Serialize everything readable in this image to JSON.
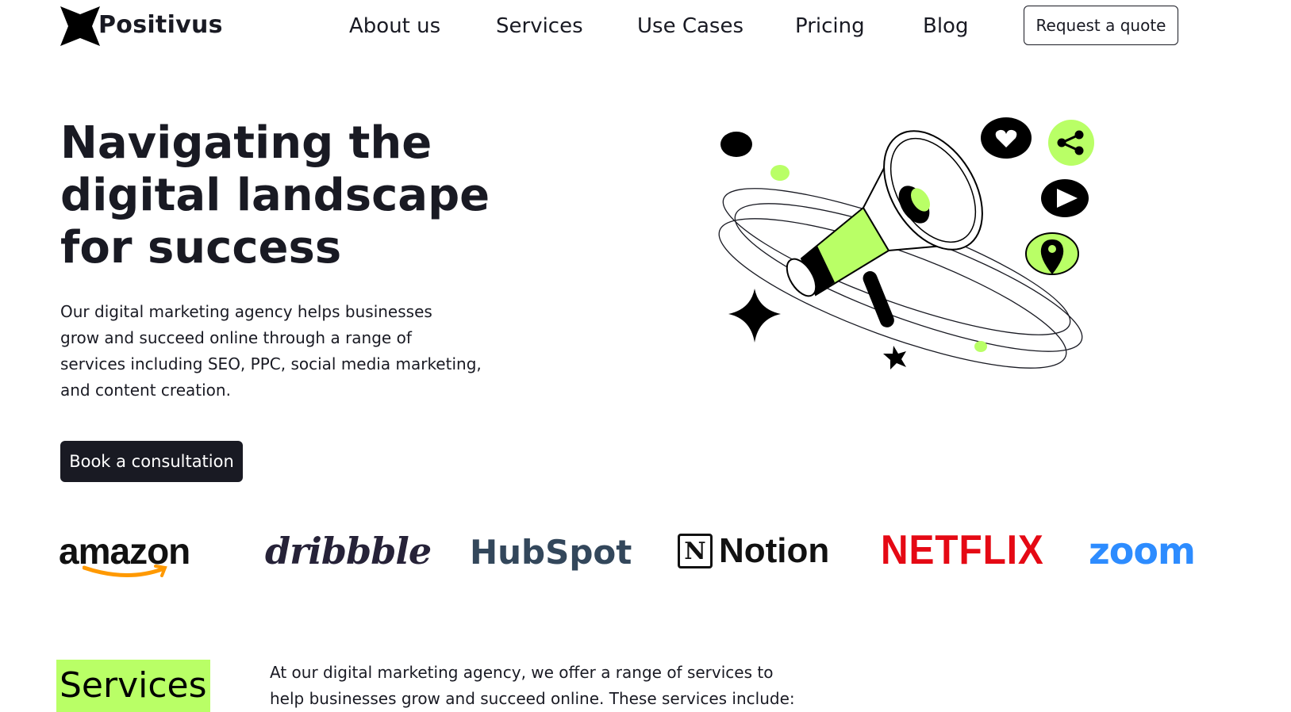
{
  "brand": {
    "name": "Positivus",
    "logo_icon": "star-burst-icon"
  },
  "nav": {
    "items": [
      "About us",
      "Services",
      "Use Cases",
      "Pricing",
      "Blog"
    ],
    "cta": "Request a quote"
  },
  "hero": {
    "title_lines": [
      "Navigating the",
      "digital landscape",
      "for success"
    ],
    "description_lines": [
      "Our digital marketing agency helps businesses",
      "grow and succeed online through a range of",
      "services including SEO, PPC, social media marketing,",
      "and content creation."
    ],
    "button": "Book a consultation",
    "illustration": "megaphone-illustration"
  },
  "clients": [
    "amazon",
    "dribbble",
    "HubSpot",
    "Notion",
    "NETFLIX",
    "zoom"
  ],
  "services": {
    "tag": "Services",
    "description_lines": [
      "At our digital marketing agency, we offer a range of services to",
      "help businesses grow and succeed online. These services include:"
    ]
  },
  "colors": {
    "accent": "#b9ff66",
    "dark": "#191a23",
    "netflix": "#e50914",
    "zoom": "#2d8cff",
    "hubspot": "#33475b",
    "hubspot_dot": "#ff7a59",
    "amazon_smile": "#ff9900"
  }
}
